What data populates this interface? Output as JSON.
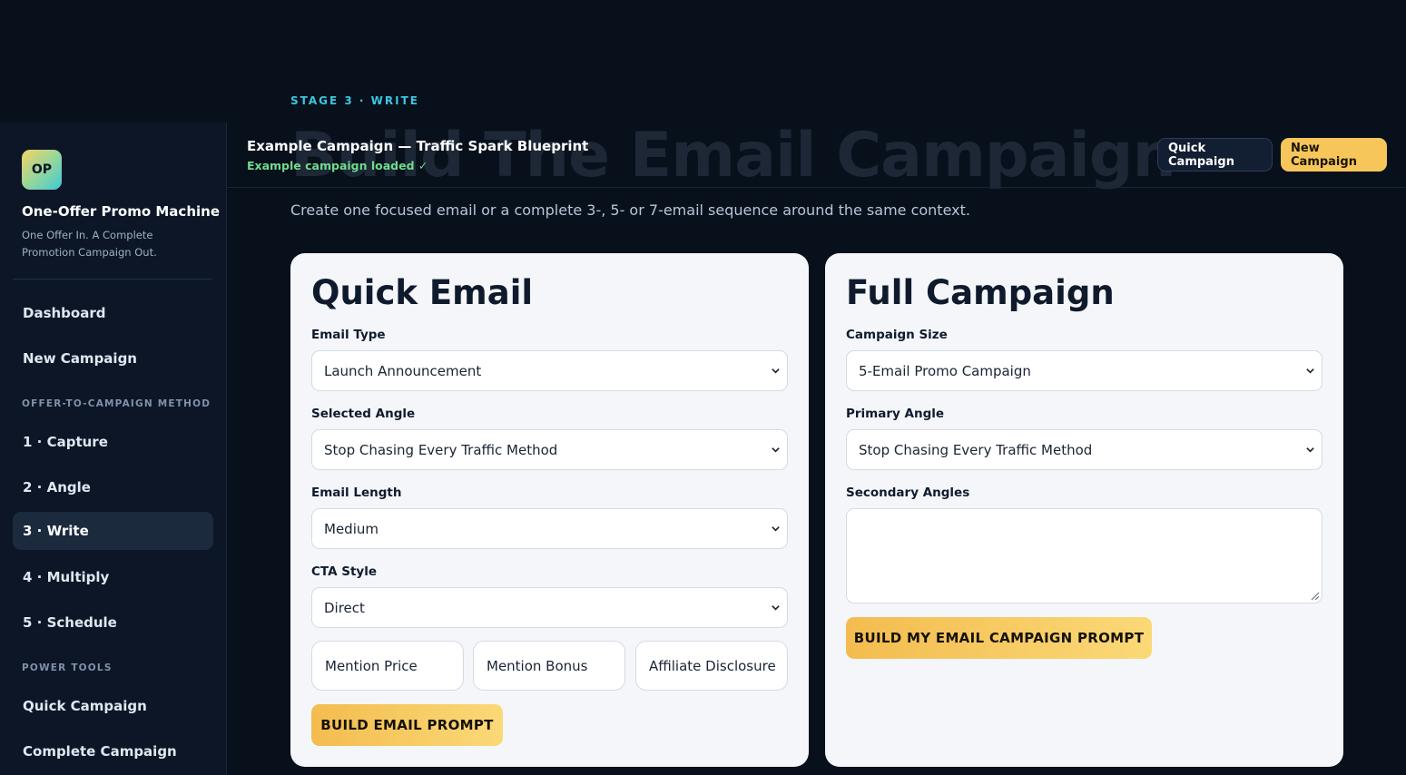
{
  "stage_label": "STAGE 3 · WRITE",
  "page_title": "Build The Email Campaign",
  "lead": "Create one focused email or a complete 3-, 5- or 7-email sequence around the same context.",
  "brand": {
    "logo_text": "OP",
    "title": "One-Offer Promo Machine",
    "subtitle": "One Offer In. A Complete Promotion Campaign Out."
  },
  "sidebar": {
    "top_items": [
      "Dashboard",
      "New Campaign"
    ],
    "method_heading": "OFFER-TO-CAMPAIGN METHOD",
    "method_items": [
      "1 · Capture",
      "2 · Angle",
      "3 · Write",
      "4 · Multiply",
      "5 · Schedule"
    ],
    "active_item": "3 · Write",
    "tools_heading": "POWER TOOLS",
    "tools_items": [
      "Quick Campaign",
      "Complete Campaign"
    ]
  },
  "topbar": {
    "campaign_name": "Example Campaign — Traffic Spark Blueprint",
    "campaign_status": "Example campaign loaded ✓",
    "quick_button": "Quick Campaign",
    "new_button": "New Campaign"
  },
  "quick_email": {
    "title": "Quick Email",
    "email_type_label": "Email Type",
    "email_type_value": "Launch Announcement",
    "angle_label": "Selected Angle",
    "angle_value": "Stop Chasing Every Traffic Method",
    "length_label": "Email Length",
    "length_value": "Medium",
    "cta_label": "CTA Style",
    "cta_value": "Direct",
    "toggles": [
      "Mention Price",
      "Mention Bonus",
      "Affiliate Disclosure"
    ],
    "button": "BUILD EMAIL PROMPT"
  },
  "full_campaign": {
    "title": "Full Campaign",
    "size_label": "Campaign Size",
    "size_value": "5-Email Promo Campaign",
    "primary_label": "Primary Angle",
    "primary_value": "Stop Chasing Every Traffic Method",
    "secondary_label": "Secondary Angles",
    "secondary_value": "",
    "button": "BUILD MY EMAIL CAMPAIGN PROMPT"
  },
  "colors": {
    "background": "#08101c",
    "sidebar": "#0c1626",
    "accent_cyan": "#3cc6e0",
    "accent_gold": "#f7c65a",
    "status_green": "#6fdc8c",
    "card": "#f4f6fa"
  }
}
